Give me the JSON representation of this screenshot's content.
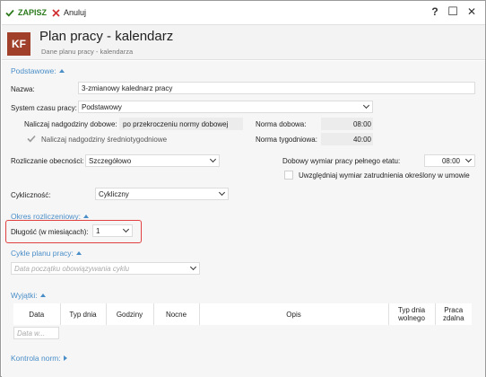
{
  "toolbar": {
    "save_label": "ZAPISZ",
    "cancel_label": "Anuluj",
    "help": "?",
    "minimize": "☐",
    "close": "✕"
  },
  "header": {
    "avatar": "KF",
    "title": "Plan pracy - kalendarz",
    "subtitle": "Dane planu pracy - kalendarza"
  },
  "sections": {
    "podstawowe": "Podstawowe:",
    "okres": "Okres rozliczeniowy:",
    "cykle": "Cykle planu pracy:",
    "wyjatki": "Wyjątki:",
    "kontrola": "Kontrola norm:"
  },
  "fields": {
    "nazwa_label": "Nazwa:",
    "nazwa_value": "3-zmianowy kalednarz pracy",
    "system_label": "System czasu pracy:",
    "system_value": "Podstawowy",
    "nadgodziny_label": "Naliczaj nadgodziny dobowe:",
    "nadgodziny_value": "po przekroczeniu normy dobowej",
    "norma_dobowa_label": "Norma dobowa:",
    "norma_dobowa_value": "08:00",
    "srednio_label": "Naliczaj nadgodziny średniotygodniowe",
    "norma_tyg_label": "Norma tygodniowa:",
    "norma_tyg_value": "40:00",
    "rozliczanie_label": "Rozliczanie obecności:",
    "rozliczanie_value": "Szczegółowo",
    "dobowy_label": "Dobowy wymiar pracy pełnego etatu:",
    "dobowy_value": "08:00",
    "uwzgledniaj_label": "Uwzględniaj wymiar zatrudnienia określony w umowie",
    "cyklicznosc_label": "Cykliczność:",
    "cyklicznosc_value": "Cykliczny",
    "dlugosc_label": "Długość (w miesiącach):",
    "dlugosc_value": "1",
    "cykl_placeholder": "Data początku obowiązywania cyklu",
    "data_placeholder": "Data w..."
  },
  "table": {
    "columns": [
      "Data",
      "Typ dnia",
      "Godziny",
      "Nocne",
      "Opis",
      "Typ dnia wolnego",
      "Praca zdalna"
    ]
  },
  "colors": {
    "accent": "#4a8ec8",
    "save": "#2a7a1a",
    "cancel": "#d03030",
    "avatar": "#a0402b",
    "highlight": "#e04040"
  }
}
